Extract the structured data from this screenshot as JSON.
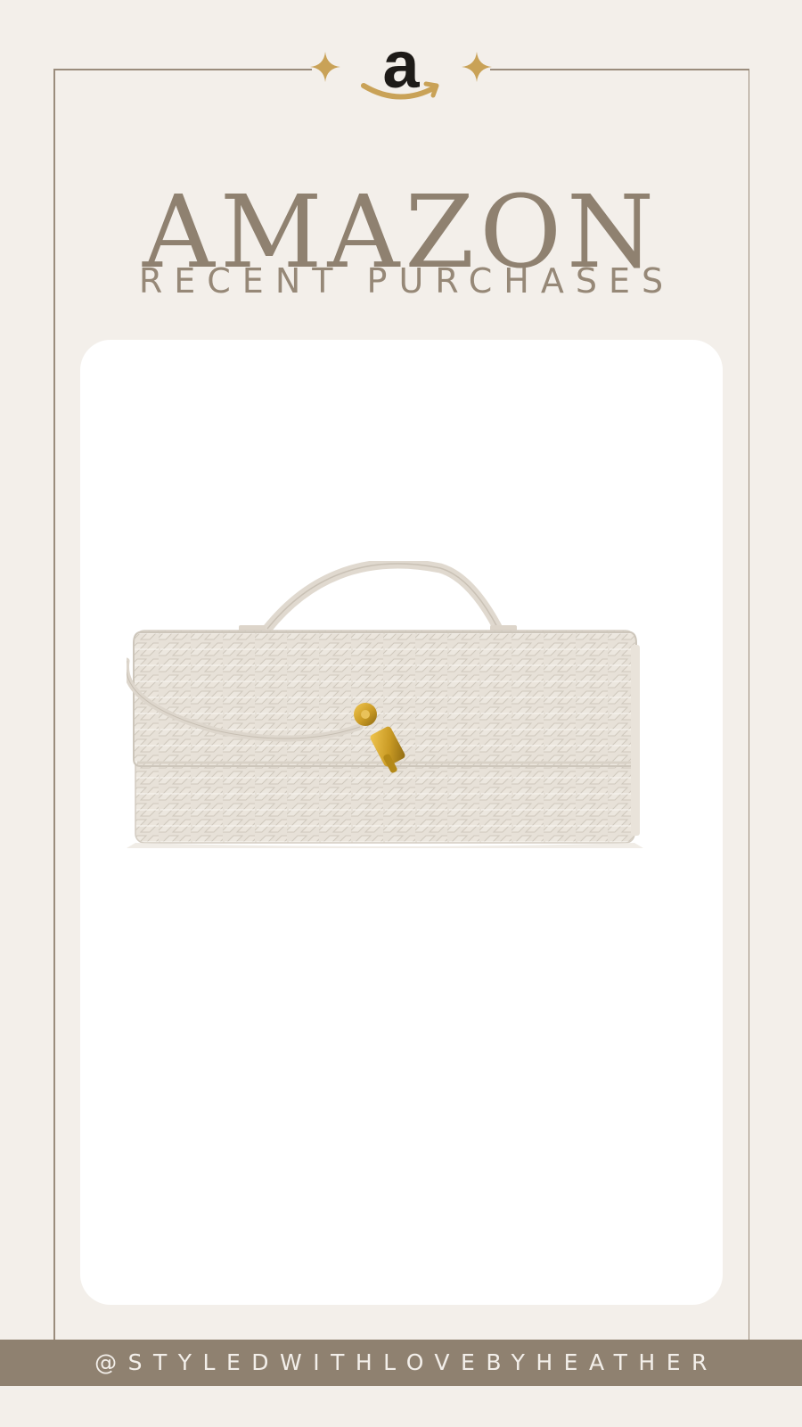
{
  "colors": {
    "background": "#f3efea",
    "accent_taupe": "#8f8170",
    "gold": "#c9a257",
    "card": "#ffffff"
  },
  "header": {
    "logo_icon": "amazon-logo-icon",
    "decoration_icon": "four-point-sparkle-icon",
    "title": "AMAZON",
    "subtitle": "RECENT PURCHASES"
  },
  "product": {
    "icon": "woven-clutch-bag-image"
  },
  "footer": {
    "handle": "@STYLEDWITHLOVEBYHEATHER"
  }
}
